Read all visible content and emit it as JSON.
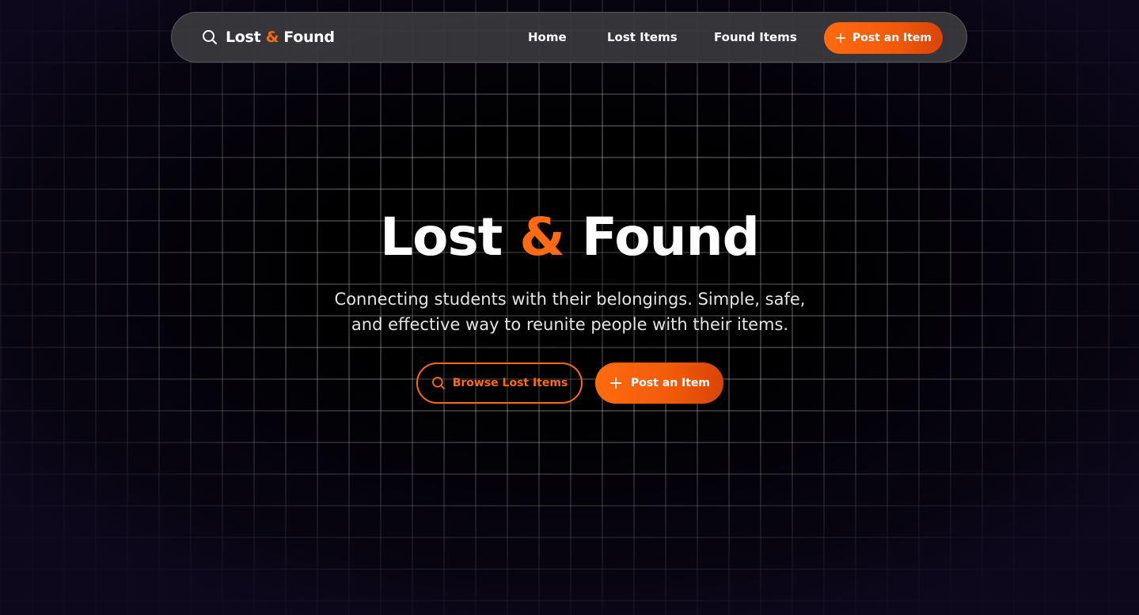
{
  "navbar": {
    "brand": {
      "icon": "search-icon",
      "word1": "Lost",
      "amp": "&",
      "word2": "Found"
    },
    "links": [
      {
        "label": "Home"
      },
      {
        "label": "Lost Items"
      },
      {
        "label": "Found Items"
      }
    ],
    "cta": {
      "icon": "plus-icon",
      "label": "Post an Item"
    }
  },
  "hero": {
    "title_word1": "Lost",
    "title_amp": "&",
    "title_word2": "Found",
    "subtitle_line1": "Connecting students with their belongings. Simple, safe,",
    "subtitle_line2": "and effective way to reunite people with their items.",
    "buttons": {
      "browse": {
        "icon": "search-icon",
        "label": "Browse Lost Items"
      },
      "post": {
        "icon": "plus-icon",
        "label": "Post an Item"
      }
    }
  },
  "colors": {
    "accent": "#ff6a13",
    "background": "#000000",
    "navbar_bg": "#3a3a3e"
  }
}
